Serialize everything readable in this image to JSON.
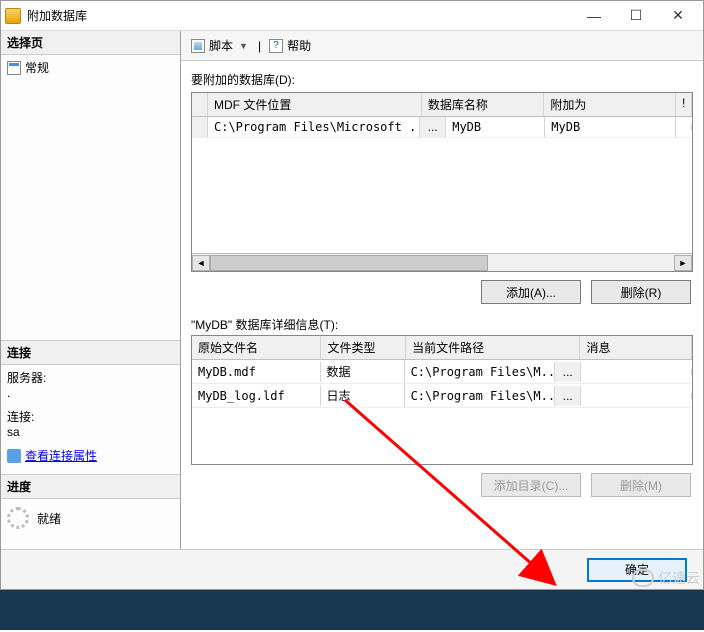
{
  "window": {
    "title": "附加数据库"
  },
  "left": {
    "select_head": "选择页",
    "general": "常规",
    "connect_head": "连接",
    "server_label": "服务器:",
    "server_value": ".",
    "conn_label": "连接:",
    "conn_value": "sa",
    "view_props": "查看连接属性",
    "progress_head": "进度",
    "ready": "就绪"
  },
  "toolbar": {
    "script": "脚本",
    "help": "帮助"
  },
  "top_grid": {
    "caption": "要附加的数据库(D):",
    "cols": {
      "mdf": "MDF 文件位置",
      "dbname": "数据库名称",
      "attach": "附加为",
      "extra": "!"
    },
    "rows": [
      {
        "mdf": "C:\\Program Files\\Microsoft ...",
        "ell": "...",
        "dbname": "MyDB",
        "attach": "MyDB"
      }
    ]
  },
  "buttons": {
    "add": "添加(A)...",
    "remove": "删除(R)",
    "add_dir": "添加目录(C)...",
    "remove2": "删除(M)",
    "ok": "确定"
  },
  "details": {
    "caption": "\"MyDB\" 数据库详细信息(T):",
    "cols": {
      "orig": "原始文件名",
      "type": "文件类型",
      "path": "当前文件路径",
      "msg": "消息"
    },
    "rows": [
      {
        "orig": "MyDB.mdf",
        "type": "数据",
        "path": "C:\\Program Files\\M...",
        "ell": "..."
      },
      {
        "orig": "MyDB_log.ldf",
        "type": "日志",
        "path": "C:\\Program Files\\M...",
        "ell": "..."
      }
    ]
  },
  "watermark": "亿速云"
}
